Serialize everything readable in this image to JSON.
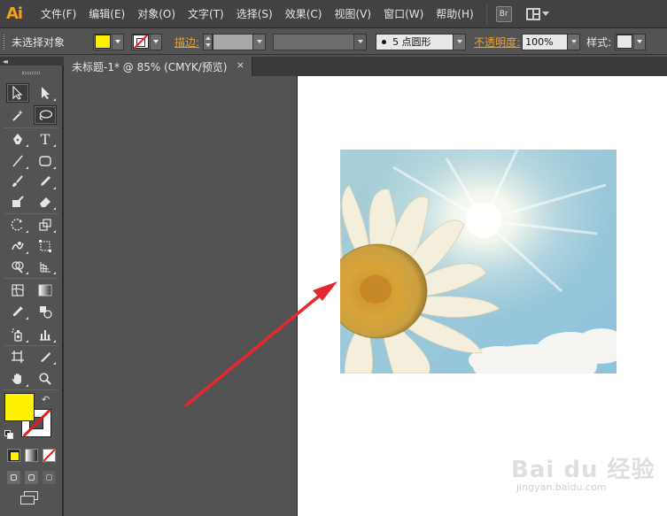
{
  "app": {
    "logo": "Ai"
  },
  "menu": {
    "items": [
      "文件(F)",
      "编辑(E)",
      "对象(O)",
      "文字(T)",
      "选择(S)",
      "效果(C)",
      "视图(V)",
      "窗口(W)",
      "帮助(H)"
    ],
    "bridge_label": "Br"
  },
  "control_bar": {
    "selection_status": "未选择对象",
    "fill_color": "#fff200",
    "stroke_label": "描边:",
    "brush_definition": "5 点圆形",
    "opacity_label": "不透明度:",
    "opacity_value": "100%",
    "style_label": "样式:"
  },
  "document": {
    "tab_title": "未标题-1* @ 85% (CMYK/预览)",
    "close_icon": "×"
  },
  "tools": {
    "type_glyph": "T",
    "swap_glyph": "↶"
  },
  "accent": {
    "arrow_color": "#e8262d",
    "app_orange": "#f3a01e"
  },
  "watermark": {
    "brand": "Bai du 经验",
    "url": "jingyan.baidu.com"
  }
}
